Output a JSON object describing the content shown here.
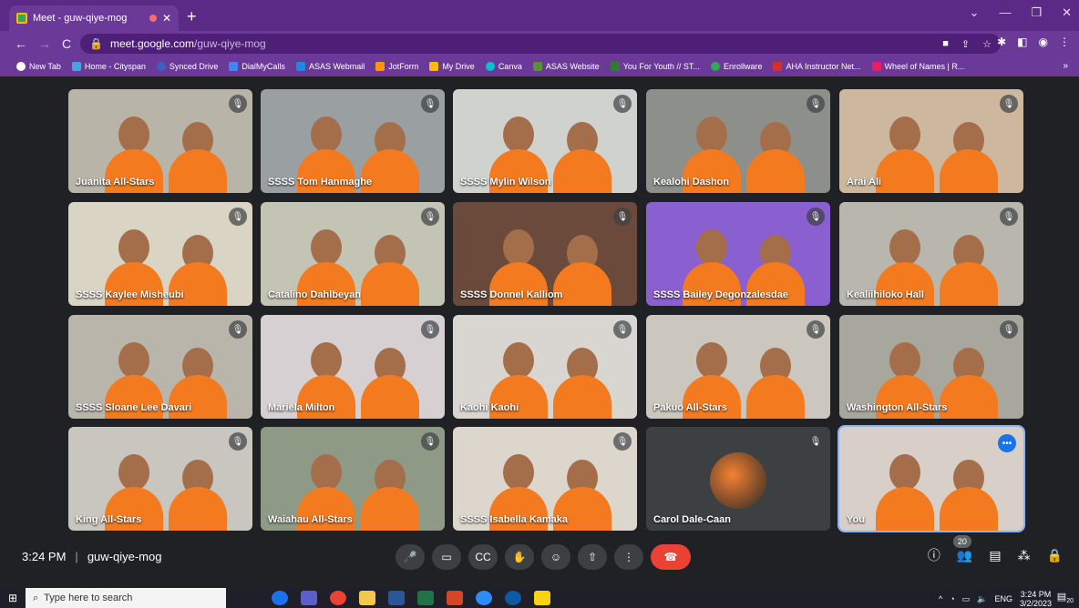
{
  "browser": {
    "tab_title": "Meet - guw-qiye-mog",
    "tab_close": "✕",
    "new_tab": "+",
    "url_host": "meet.google.com",
    "url_path": "/guw-qiye-mog",
    "controls": {
      "minimize": "—",
      "restore": "❐",
      "close": "✕",
      "chevron": "⌄"
    },
    "bookmarks": [
      "New Tab",
      "Home - Cityspan",
      "Synced Drive",
      "DialMyCalls",
      "ASAS Webmail",
      "JotForm",
      "My Drive",
      "Canva",
      "ASAS Website",
      "You For Youth // ST...",
      "Enrollware",
      "AHA Instructor Net...",
      "Wheel of Names | R..."
    ],
    "bookmarks_more": "»"
  },
  "tiles": [
    {
      "name": "Juanita All-Stars",
      "wall": "#b9b4a8",
      "muted": true
    },
    {
      "name": "SSSS Tom Hanmaghe",
      "wall": "#9aa0a2",
      "muted": true
    },
    {
      "name": "SSSS Mylin Wilson",
      "wall": "#cfd2cd",
      "muted": true
    },
    {
      "name": "Kealohi Dashon",
      "wall": "#8d8f8b",
      "muted": true
    },
    {
      "name": "Arai Ali",
      "wall": "#cdb89f",
      "muted": true
    },
    {
      "name": "SSSS Kaylee Misheubi",
      "wall": "#d9d4c4",
      "muted": true
    },
    {
      "name": "Catalino Dahlbeyan",
      "wall": "#c4c4b4",
      "muted": true
    },
    {
      "name": "SSSS Donnel Kalliom",
      "wall": "#6b4a3c",
      "muted": true
    },
    {
      "name": "SSSS Bailey Degonzalesdae",
      "wall": "#8a5fd0",
      "muted": true
    },
    {
      "name": "Kealiihiloko Hall",
      "wall": "#b8b6ad",
      "muted": true
    },
    {
      "name": "SSSS Sloane Lee Davari",
      "wall": "#bab5ab",
      "muted": true
    },
    {
      "name": "Mariela Milton",
      "wall": "#d6d0d2",
      "muted": true
    },
    {
      "name": "Kaohi Kaohi",
      "wall": "#d9d6d2",
      "muted": true
    },
    {
      "name": "Pakuo All-Stars",
      "wall": "#cbc6be",
      "muted": true
    },
    {
      "name": "Washington All-Stars",
      "wall": "#a8a79e",
      "muted": true
    },
    {
      "name": "King All-Stars",
      "wall": "#c9c5bf",
      "muted": true
    },
    {
      "name": "Waiahau All-Stars",
      "wall": "#8f9a86",
      "muted": true
    },
    {
      "name": "SSSS Isabella Kamaka",
      "wall": "#dcd6cc",
      "muted": true
    },
    {
      "name": "Carol Dale-Caan",
      "wall": "#3c4043",
      "muted": true,
      "avatar": true
    },
    {
      "name": "You",
      "wall": "#d8cfc8",
      "muted": false,
      "you": true
    }
  ],
  "meeting": {
    "time": "3:24 PM",
    "separator": "|",
    "code": "guw-qiye-mog",
    "participants": "20"
  },
  "taskbar": {
    "search_placeholder": "Type here to search",
    "lang": "ENG",
    "time": "3:24 PM",
    "date": "3/2/2023",
    "notif_count": "20"
  },
  "colors": {
    "chrome_purple": "#5b2a86",
    "meet_bg": "#202124",
    "end_call": "#ea4335",
    "accent_blue": "#1a73e8"
  }
}
